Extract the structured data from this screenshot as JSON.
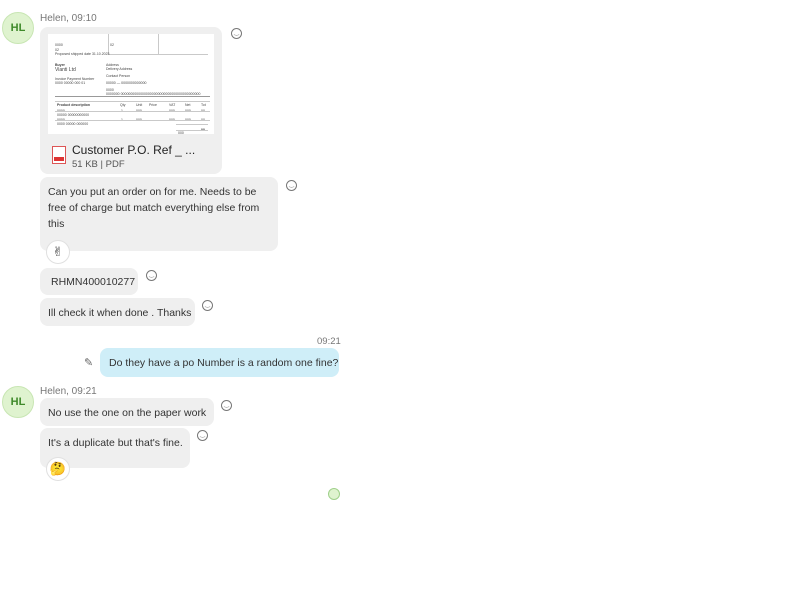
{
  "chat": {
    "group1": {
      "avatar_initials": "HL",
      "sender_line": "Helen, 09:10",
      "attachment": {
        "file_name": "Customer P.O. Ref _ ...",
        "file_meta": "51 KB | PDF",
        "preview": {
          "company": "Vianti Ltd",
          "table_header": "Product description"
        }
      },
      "messages": [
        {
          "text": "Can you put an order on for me. Needs to be free of charge but match everything else from this",
          "reaction": "✌"
        },
        {
          "text": "RHMN400010277"
        },
        {
          "text": "Ill check it when done . Thanks"
        }
      ]
    },
    "outgoing": {
      "time": "09:21",
      "text": "Do they have a po Number is a random one fine?"
    },
    "group2": {
      "avatar_initials": "HL",
      "sender_line": "Helen, 09:21",
      "messages": [
        {
          "text": "No use the one on the paper work"
        },
        {
          "text": "It's a duplicate but that's fine.",
          "reaction": "🤔"
        }
      ]
    },
    "read_receipt": "seen-avatar",
    "icons": {
      "reaction_add": "smiley-icon",
      "edit": "pencil-icon",
      "file": "pdf-file-icon"
    },
    "colors": {
      "incoming_bubble": "#efefef",
      "outgoing_bubble": "#cfeef8",
      "avatar_bg": "#dff3cf",
      "avatar_text": "#3f8a2a"
    }
  }
}
